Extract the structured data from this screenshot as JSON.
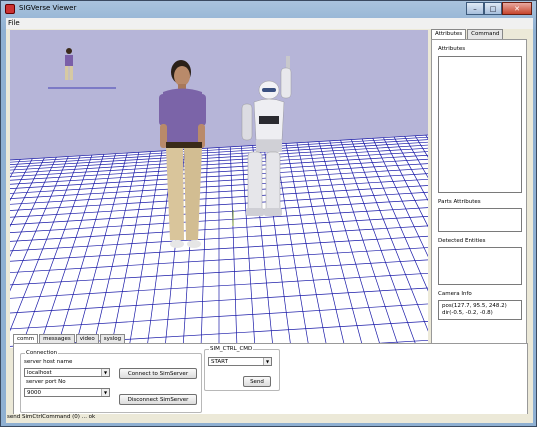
{
  "window": {
    "title": "SIGVerse Viewer"
  },
  "menu": {
    "file_label": "File"
  },
  "right_panel": {
    "tabs": [
      "Attributes",
      "Command"
    ],
    "attributes_label": "Attributes",
    "parts_attributes_label": "Parts Attributes",
    "detected_entities_label": "Detected Entities",
    "camera_info_label": "Camera Info",
    "camera_pos": "pos(127.7, 95.5, 248.2)",
    "camera_dir": "dir(-0.5, -0.2, -0.8)"
  },
  "bottom_panel": {
    "tabs": [
      "comm",
      "messages",
      "video",
      "syslog"
    ],
    "connection": {
      "group_label": "Connection",
      "host_label": "server host name",
      "host_value": "localhost",
      "port_label": "server port No",
      "port_value": "9000",
      "connect_label": "Connect to SimServer",
      "disconnect_label": "Disconnect SimServer"
    },
    "sim_ctrl": {
      "group_label": "SIM_CTRL_CMD",
      "command_value": "START",
      "send_label": "Send"
    }
  },
  "status_bar": {
    "text": "send SimCtrlCommand (0) ... ok"
  },
  "colors": {
    "sky": "#b6b5d8",
    "grid": "#1a1aa8",
    "floor": "#ffffff"
  }
}
